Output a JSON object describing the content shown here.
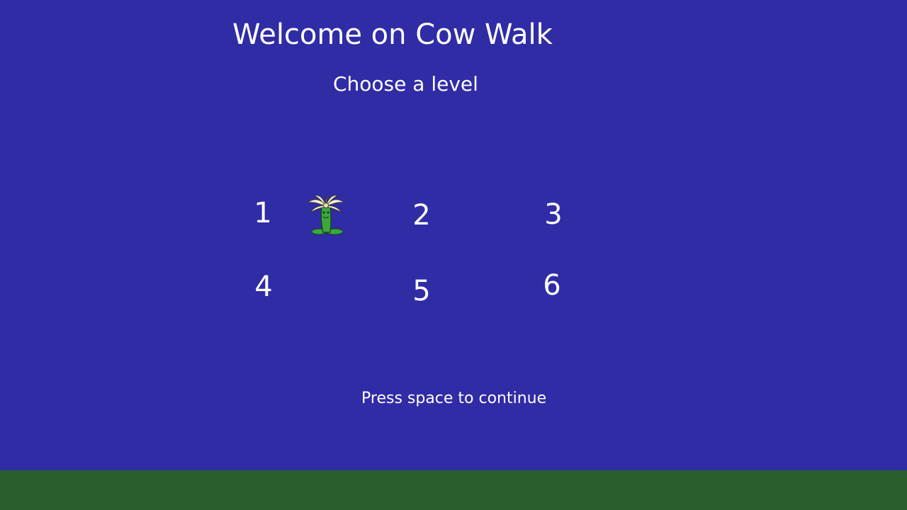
{
  "game": {
    "title": "Welcome on Cow Walk",
    "subtitle": "Choose a level",
    "levels": [
      {
        "label": "1"
      },
      {
        "label": "2"
      },
      {
        "label": "3"
      },
      {
        "label": "4"
      },
      {
        "label": "5"
      },
      {
        "label": "6"
      }
    ],
    "selected_level": 1,
    "selection_cursor": "flower-icon",
    "prompt": "Press space to continue"
  },
  "colors": {
    "sky": "#302ca6",
    "ground": "#2b5e2d",
    "text": "#ffffff",
    "flower_stem": "#3aa83a",
    "flower_petals": "#f5f2d6"
  }
}
